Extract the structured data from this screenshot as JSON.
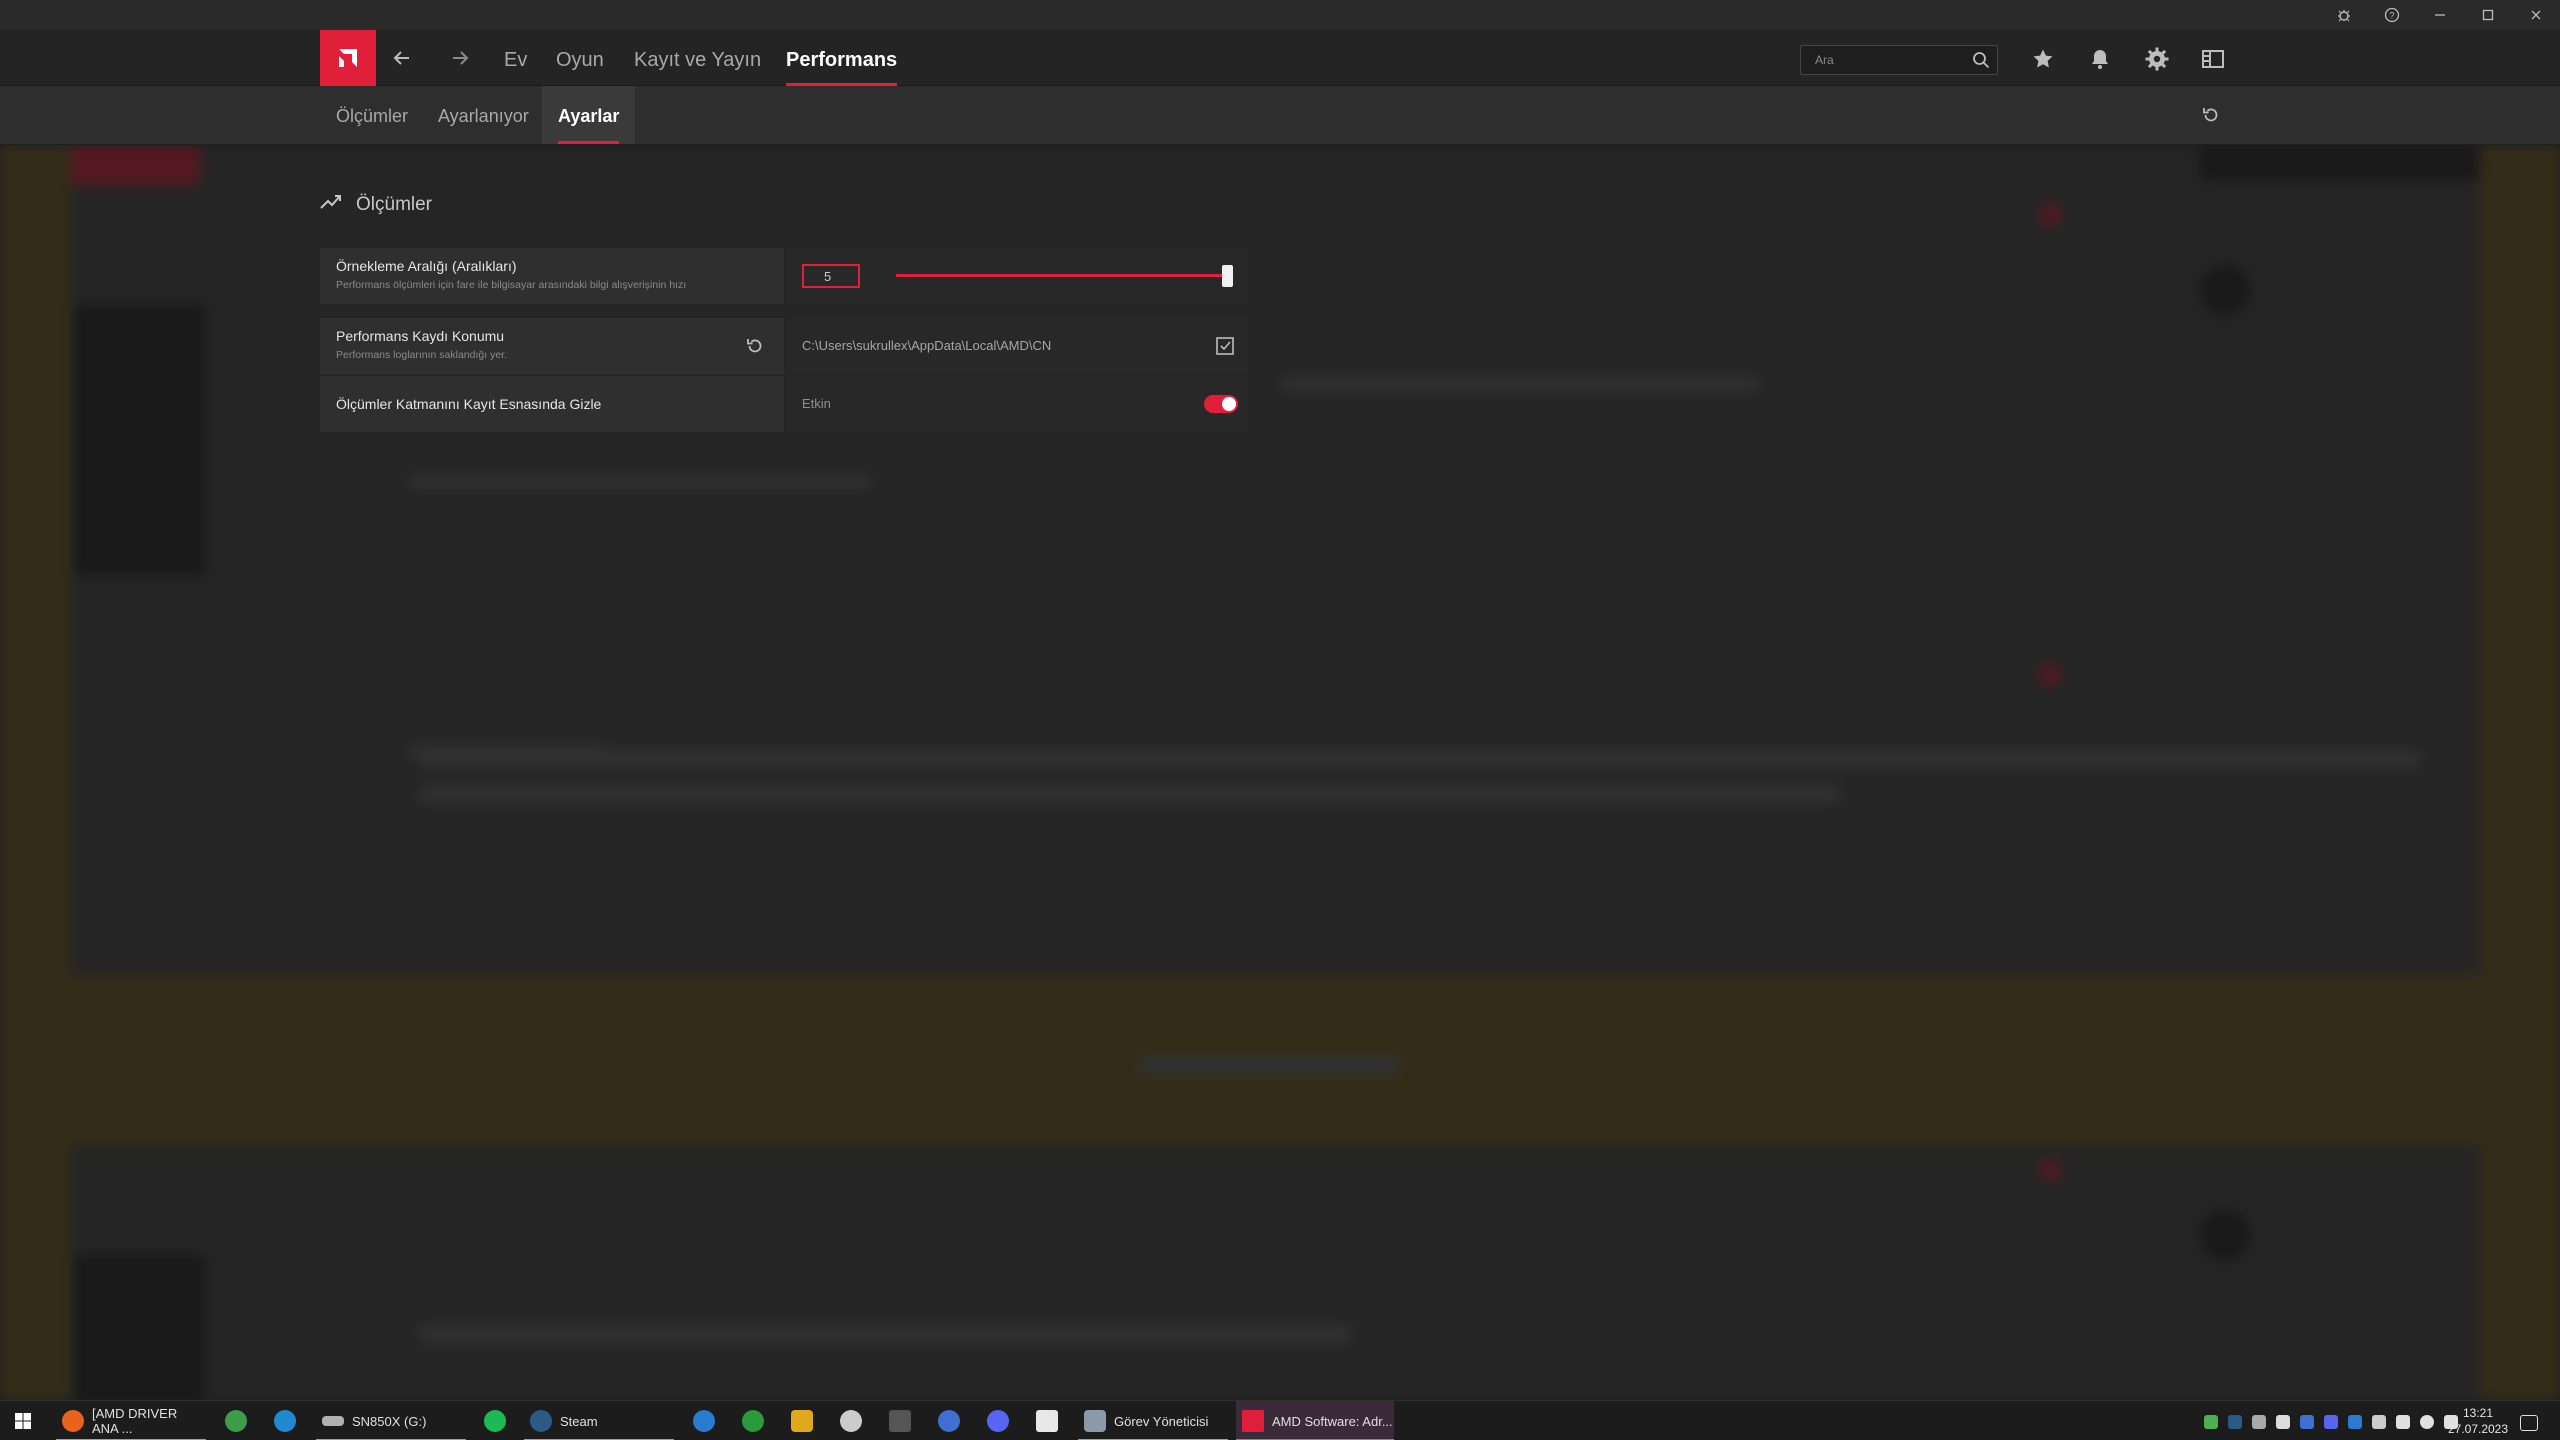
{
  "window": {
    "controls": [
      "bug-report",
      "help",
      "minimize",
      "maximize",
      "close"
    ]
  },
  "nav": {
    "tabs": [
      {
        "label": "Ev",
        "active": false
      },
      {
        "label": "Oyun",
        "active": false
      },
      {
        "label": "Kayıt ve Yayın",
        "active": false
      },
      {
        "label": "Performans",
        "active": true
      }
    ],
    "search_placeholder": "Ara"
  },
  "subnav": {
    "tabs": [
      {
        "label": "Ölçümler",
        "active": false
      },
      {
        "label": "Ayarlanıyor",
        "active": false
      },
      {
        "label": "Ayarlar",
        "active": true
      }
    ]
  },
  "section": {
    "title": "Ölçümler"
  },
  "settings": {
    "sampling": {
      "title": "Örnekleme Aralığı (Aralıkları)",
      "subtitle": "Performans ölçümleri için fare ile bilgisayar arasındaki bilgi alışverişinin hızı",
      "value": "5",
      "slider_fraction": 1.0
    },
    "log_location": {
      "title": "Performans Kaydı Konumu",
      "subtitle": "Performans loglarının saklandığı yer.",
      "path": "C:\\Users\\sukrullex\\AppData\\Local\\AMD\\CN"
    },
    "hide_overlay": {
      "title": "Ölçümler Katmanını Kayıt Esnasında Gizle",
      "state": "Etkin",
      "enabled": true
    }
  },
  "taskbar": {
    "items": [
      {
        "label": "[AMD DRIVER ANA ..."
      },
      {
        "label": "SN850X (G:)"
      },
      {
        "label": "Steam"
      },
      {
        "label": "Görev Yöneticisi"
      },
      {
        "label": "AMD Software: Adr..."
      }
    ],
    "time": "13:21",
    "date": "27.07.2023"
  },
  "colors": {
    "accent": "#e0203b",
    "panel": "#2f2f2f",
    "topbar": "#242424"
  }
}
